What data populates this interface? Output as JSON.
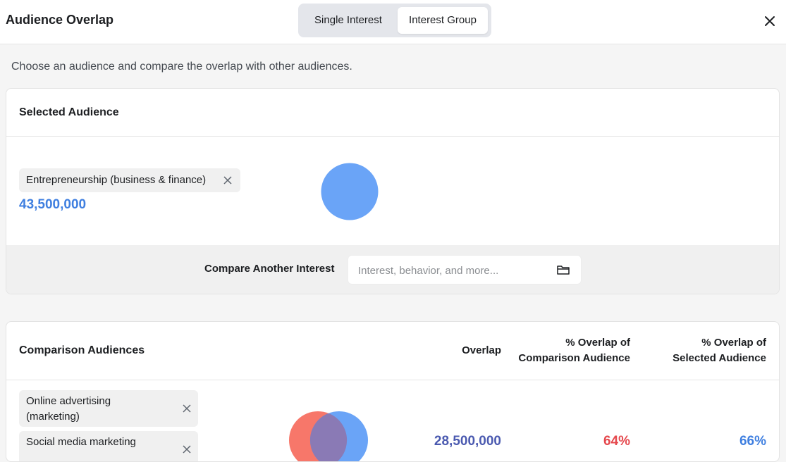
{
  "header": {
    "title": "Audience Overlap",
    "tabs": [
      {
        "label": "Single Interest",
        "active": false
      },
      {
        "label": "Interest Group",
        "active": true
      }
    ],
    "close_icon": "close-icon"
  },
  "subtitle": "Choose an audience and compare the overlap with other audiences.",
  "selected_audience": {
    "title": "Selected Audience",
    "chip_label": "Entrepreneurship (business & finance)",
    "count": "43,500,000",
    "circle_color": "#6aa4f7"
  },
  "compare": {
    "label": "Compare Another Interest",
    "placeholder": "Interest, behavior, and more...",
    "input_value": "",
    "icon": "folder-icon"
  },
  "comparison": {
    "title": "Comparison Audiences",
    "col_overlap": "Overlap",
    "col_pct_comparison_1": "% Overlap of",
    "col_pct_comparison_2": "Comparison Audience",
    "col_pct_selected_1": "% Overlap of",
    "col_pct_selected_2": "Selected Audience",
    "row": {
      "chip1_line1": "Online advertising",
      "chip1_line2": "(marketing)",
      "chip2_line1": "Social media marketing",
      "overlap": "28,500,000",
      "pct_comparison": "64%",
      "pct_selected": "66%"
    }
  },
  "colors": {
    "accent_blue": "#3f7fe0",
    "overlap_purple": "#4b5ab0",
    "pct_red": "#e5484d",
    "venn_red": "#f7776a",
    "venn_blue": "#6aa4f7"
  }
}
